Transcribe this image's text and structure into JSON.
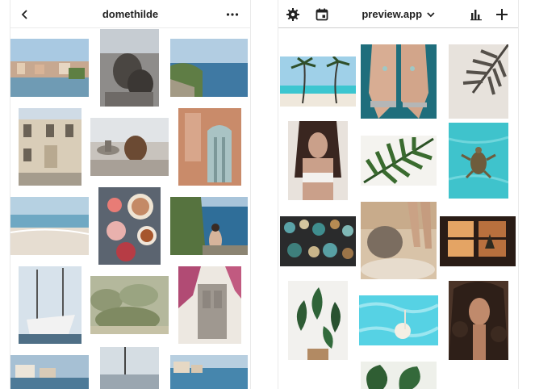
{
  "left_app": {
    "title": "domethilde",
    "icons": {
      "back": "chevron-left-icon",
      "more": "more-horizontal-icon"
    }
  },
  "right_app": {
    "title": "preview.app",
    "icons": {
      "settings": "gear-icon",
      "calendar": "calendar-icon",
      "title_dropdown": "chevron-down-icon",
      "stats": "bar-chart-icon",
      "add": "plus-icon"
    }
  },
  "colors": {
    "sky": "#8ab6d6",
    "sea": "#3d7fa6",
    "turquoise": "#41c5cf",
    "stone": "#b9aa95",
    "terracotta": "#c98b6a",
    "foliage": "#4b7a3a",
    "palm": "#2f5a2a",
    "dark": "#2b2522",
    "sand": "#e9dccb"
  }
}
